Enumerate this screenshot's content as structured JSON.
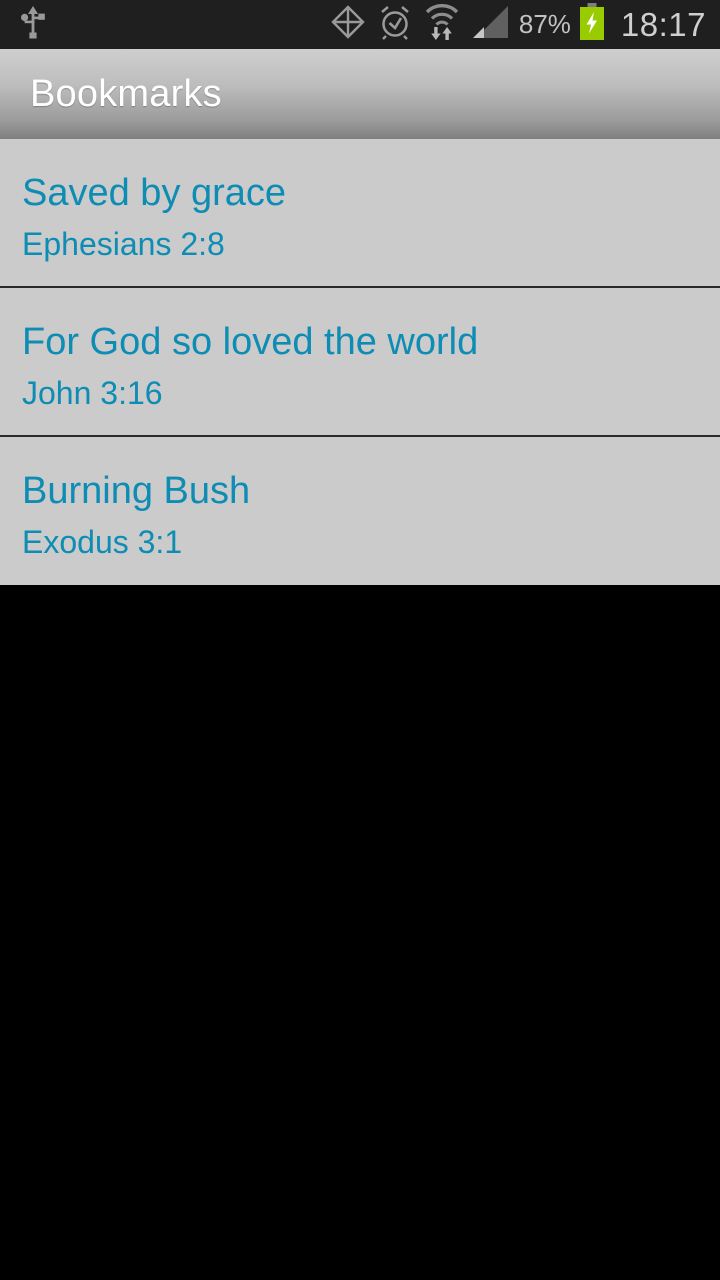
{
  "status_bar": {
    "left_icons": [
      {
        "name": "usb-icon",
        "label": "USB connected"
      }
    ],
    "right_icons": [
      {
        "name": "gps-location-icon",
        "label": "GPS active"
      },
      {
        "name": "alarm-clock-icon",
        "label": "Alarm set"
      },
      {
        "name": "wifi-data-transfer-icon",
        "label": "Wi-Fi connected"
      },
      {
        "name": "cellular-signal-icon",
        "label": "Mobile signal"
      }
    ],
    "battery_percent": "87%",
    "battery_state": "charging",
    "clock": "18:17",
    "background_color": "#1f1f1f",
    "text_color": "#b6b6b6",
    "battery_fill_color": "#99cc00"
  },
  "action_bar": {
    "title": "Bookmarks",
    "title_color": "#ffffff",
    "gradient_top": "#cfcfcf",
    "gradient_bottom": "#7f7f7f"
  },
  "list": {
    "background_color": "#cbcbcb",
    "accent_color": "#0d8cb4",
    "divider_color": "#2a2a2a",
    "items": [
      {
        "title": "Saved by grace",
        "subtitle": "Ephesians 2:8"
      },
      {
        "title": "For God so loved the world",
        "subtitle": "John 3:16"
      },
      {
        "title": "Burning Bush",
        "subtitle": "Exodus 3:1"
      }
    ]
  },
  "empty_area": {
    "background_color": "#000000"
  }
}
